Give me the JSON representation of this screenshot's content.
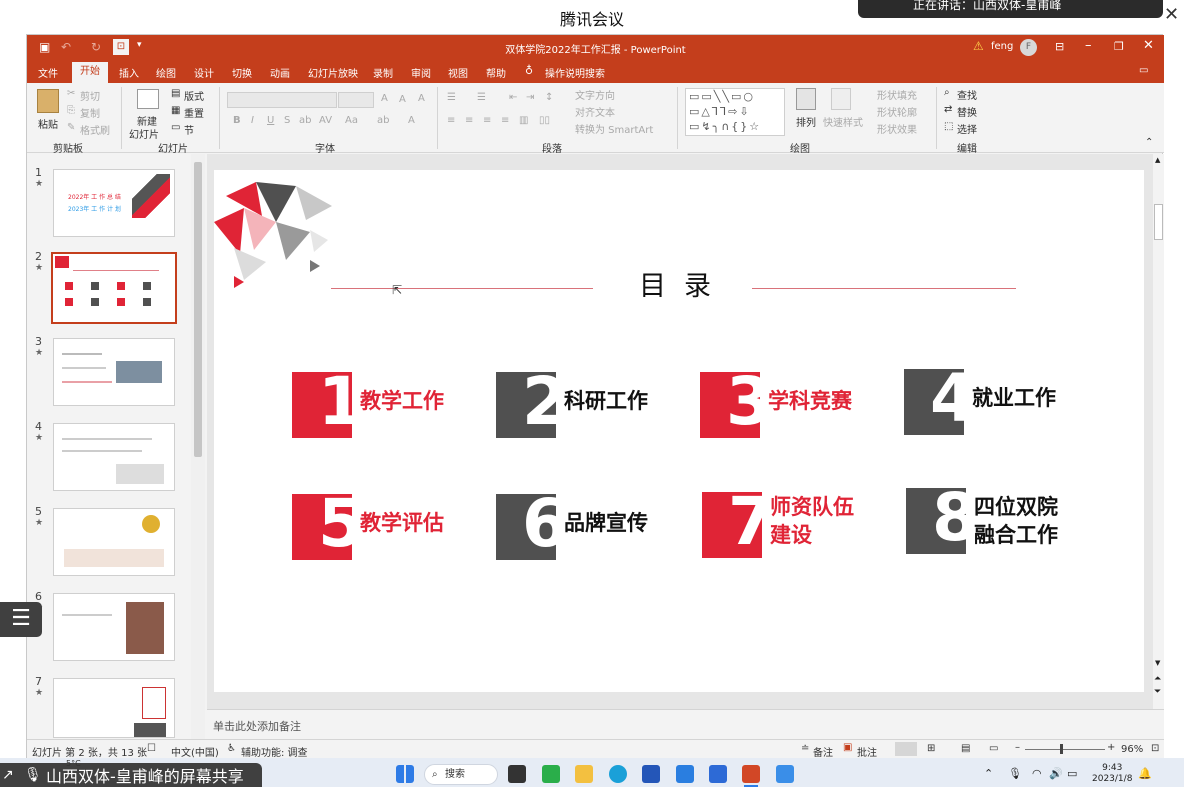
{
  "meeting": {
    "title": "腾讯会议",
    "notice": "正在讲话：山西双体-皇甫峰"
  },
  "taskbar": {
    "share_label": "山西双体-皇甫峰的屏幕共享",
    "search_label": "搜索",
    "time": "9:43",
    "date": "2023/1/8",
    "weather": "5°C"
  },
  "ppt": {
    "doc_title": "双体学院2022年工作汇报 - PowerPoint",
    "user_name": "feng",
    "user_initial": "F",
    "tabs": [
      "文件",
      "开始",
      "插入",
      "绘图",
      "设计",
      "切换",
      "动画",
      "幻灯片放映",
      "录制",
      "审阅",
      "视图",
      "帮助"
    ],
    "tell_me": "操作说明搜索",
    "ribbon": {
      "paste": "粘贴",
      "cut": "剪切",
      "copy": "复制",
      "format_painter": "格式刷",
      "new_slide_1": "新建",
      "new_slide_2": "幻灯片",
      "layout": "版式",
      "reset": "重置",
      "section": "节",
      "text_direction": "文字方向",
      "align_text": "对齐文本",
      "smartart": "转换为 SmartArt",
      "arrange": "排列",
      "quick_styles": "快速样式",
      "shape_fill": "形状填充",
      "shape_outline": "形状轮廓",
      "shape_effects": "形状效果",
      "find": "查找",
      "replace": "替换",
      "select": "选择",
      "groups": [
        "剪贴板",
        "幻灯片",
        "字体",
        "段落",
        "绘图",
        "编辑"
      ]
    },
    "thumbnails": [
      {
        "num": "1",
        "star": "★",
        "line1": "2022年 工 作 总 结",
        "line2": "2023年 工 作 计 划"
      },
      {
        "num": "2",
        "star": "★"
      },
      {
        "num": "3",
        "star": "★"
      },
      {
        "num": "4",
        "star": "★"
      },
      {
        "num": "5",
        "star": "★"
      },
      {
        "num": "6",
        "star": "★"
      },
      {
        "num": "7",
        "star": "★"
      }
    ],
    "slide": {
      "heading": "目录",
      "items": [
        {
          "digit": "1",
          "label": "教学工作",
          "color": "red"
        },
        {
          "digit": "2",
          "label": "科研工作",
          "color": "gray"
        },
        {
          "digit": "3",
          "label": "学科竞赛",
          "color": "red"
        },
        {
          "digit": "4",
          "label": "就业工作",
          "color": "gray"
        },
        {
          "digit": "5",
          "label": "教学评估",
          "color": "red"
        },
        {
          "digit": "6",
          "label": "品牌宣传",
          "color": "gray"
        },
        {
          "digit": "7",
          "label_1": "师资队伍",
          "label_2": "建设",
          "color": "red"
        },
        {
          "digit": "8",
          "label_1": "四位双院",
          "label_2": "融合工作",
          "color": "gray"
        }
      ]
    },
    "notes_placeholder": "单击此处添加备注",
    "status": {
      "slide_count": "幻灯片 第 2 张，共 13 张",
      "language": "中文(中国)",
      "accessibility": "辅助功能: 调查",
      "notes_btn": "备注",
      "comments_btn": "批注",
      "zoom": "96%"
    }
  },
  "colors": {
    "ppt_red": "#c43e1c",
    "slide_red": "#e02436",
    "slide_gray": "#505050"
  }
}
